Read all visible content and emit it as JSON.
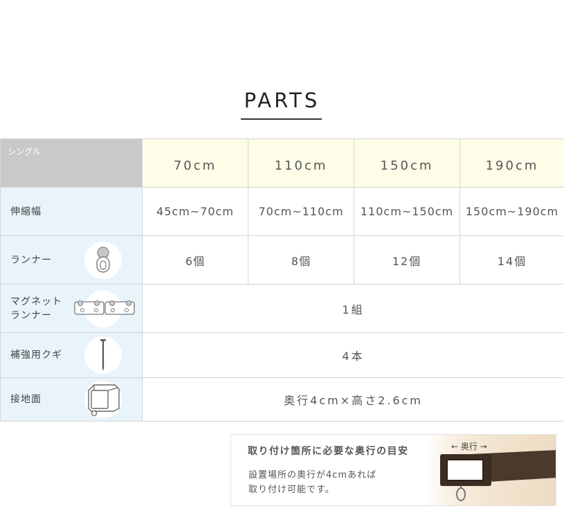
{
  "heading": "PARTS",
  "table": {
    "corner_label": "シングル",
    "sizes": [
      "70cm",
      "110cm",
      "150cm",
      "190cm"
    ],
    "extension": {
      "label": "伸縮幅",
      "values": [
        "45cm~70cm",
        "70cm~110cm",
        "110cm~150cm",
        "150cm~190cm"
      ]
    },
    "runner": {
      "label": "ランナー",
      "icon": "runner-icon",
      "values": [
        "6個",
        "8個",
        "12個",
        "14個"
      ]
    },
    "magnet_runner": {
      "label_line1": "マグネット",
      "label_line2": "ランナー",
      "icon": "magnet-runner-icon",
      "value": "1組"
    },
    "nail": {
      "label": "補強用クギ",
      "icon": "nail-icon",
      "value": "4本"
    },
    "contact_surface": {
      "label": "接地面",
      "icon": "bracket-icon",
      "value": "奥行4cm×高さ2.6cm"
    }
  },
  "tip": {
    "title": "取り付け箇所に必要な奥行の目安",
    "body_line1": "設置場所の奥行が4cmあれば",
    "body_line2": "取り付け可能です。",
    "depth_label": "← 奥行 →",
    "photo_icon": "rail-end-photo"
  },
  "colors": {
    "header_gray": "#c9c9c9",
    "header_yellow": "#fefde8",
    "label_blue": "#e9f3fa",
    "rail_brown": "#4a3a2c"
  }
}
